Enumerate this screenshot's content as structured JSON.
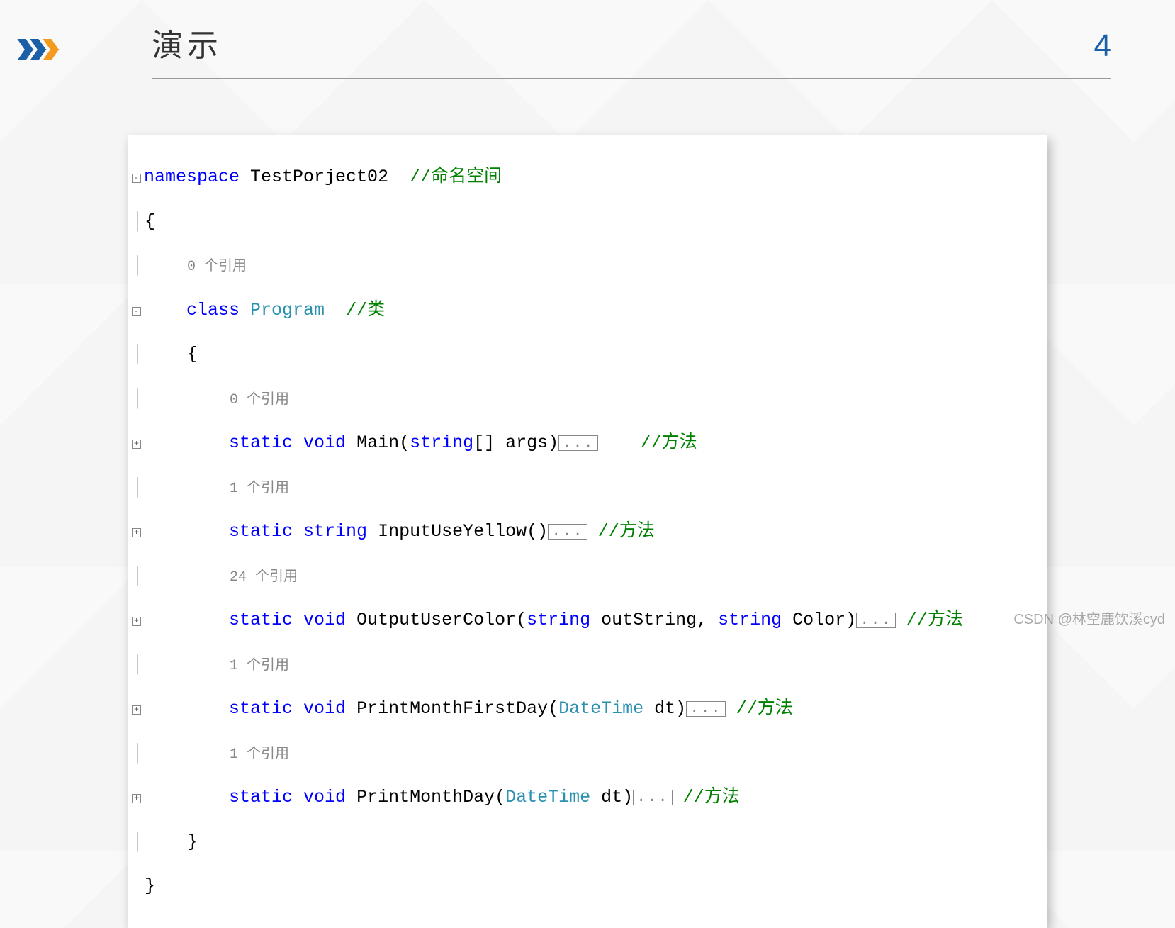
{
  "header": {
    "title": "演示",
    "page_number": "4"
  },
  "code": {
    "namespace_kw": "namespace",
    "namespace_name": " TestPorject02  ",
    "namespace_comment": "//命名空间",
    "open_brace": "{",
    "ref0": "0 个引用",
    "class_kw": "class",
    "class_name": " Program  ",
    "class_comment": "//类",
    "class_open": "{",
    "m1_ref": "0 个引用",
    "m1_sig_kw1": "static",
    "m1_sig_kw2": " void",
    "m1_name": " Main(",
    "m1_param_t": "string",
    "m1_rest": "[] args)",
    "m1_comment": "//方法",
    "m2_ref": "1 个引用",
    "m2_sig_kw1": "static",
    "m2_sig_kw2": " string",
    "m2_name": " InputUseYellow()",
    "m2_comment": "//方法",
    "m3_ref": "24 个引用",
    "m3_sig_kw1": "static",
    "m3_sig_kw2": " void",
    "m3_name": " OutputUserColor(",
    "m3_p1_t": "string",
    "m3_p1_n": " outString, ",
    "m3_p2_t": "string",
    "m3_p2_n": " Color)",
    "m3_comment": "//方法",
    "m4_ref": "1 个引用",
    "m4_sig_kw1": "static",
    "m4_sig_kw2": " void",
    "m4_name": " PrintMonthFirstDay(",
    "m4_p_t": "DateTime",
    "m4_p_n": " dt)",
    "m4_comment": "//方法",
    "m5_ref": "1 个引用",
    "m5_sig_kw1": "static",
    "m5_sig_kw2": " void",
    "m5_name": " PrintMonthDay(",
    "m5_p_t": "DateTime",
    "m5_p_n": " dt)",
    "m5_comment": "//方法",
    "class_close": "}",
    "ns_close": "}",
    "ellipsis": "..."
  },
  "watermark": "CSDN @林空鹿饮溪cyd"
}
